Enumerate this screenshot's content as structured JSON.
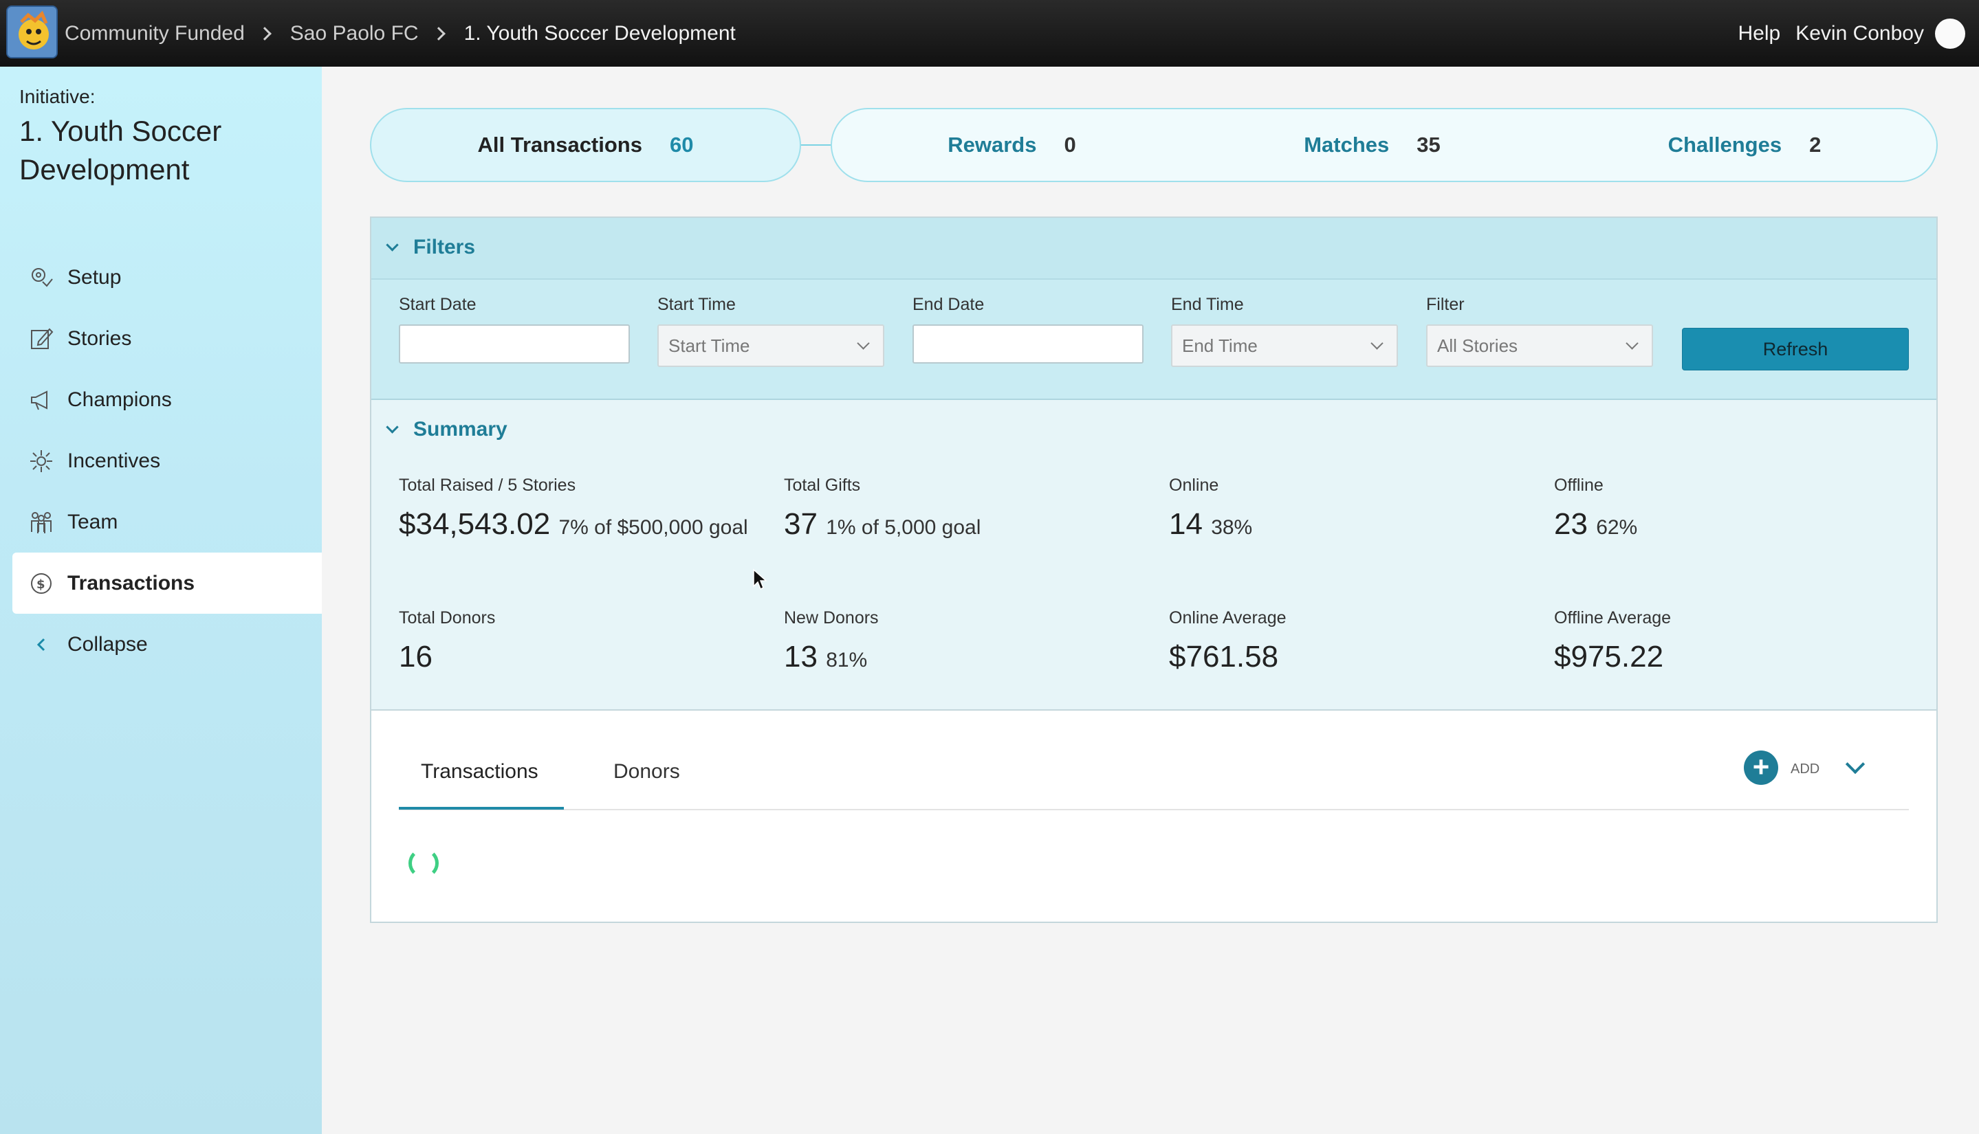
{
  "topbar": {
    "breadcrumbs": [
      "Community Funded",
      "Sao Paolo FC",
      "1. Youth Soccer Development"
    ],
    "help": "Help",
    "user": "Kevin Conboy"
  },
  "sidebar": {
    "initiative_label": "Initiative:",
    "initiative_title": "1. Youth Soccer Development",
    "items": [
      {
        "label": "Setup",
        "icon": "setup-icon"
      },
      {
        "label": "Stories",
        "icon": "edit-icon"
      },
      {
        "label": "Champions",
        "icon": "megaphone-icon"
      },
      {
        "label": "Incentives",
        "icon": "sparkle-icon"
      },
      {
        "label": "Team",
        "icon": "team-icon"
      },
      {
        "label": "Transactions",
        "icon": "money-icon",
        "active": true
      },
      {
        "label": "Collapse",
        "icon": "chevron-left-icon"
      }
    ]
  },
  "tabs": {
    "all": {
      "label": "All Transactions",
      "count": "60"
    },
    "rewards": {
      "label": "Rewards",
      "count": "0"
    },
    "matches": {
      "label": "Matches",
      "count": "35"
    },
    "challenges": {
      "label": "Challenges",
      "count": "2"
    }
  },
  "filters": {
    "title": "Filters",
    "start_date_label": "Start Date",
    "start_time_label": "Start Time",
    "start_time_value": "Start Time",
    "end_date_label": "End Date",
    "end_time_label": "End Time",
    "end_time_value": "End Time",
    "filter_label": "Filter",
    "filter_value": "All Stories",
    "refresh": "Refresh"
  },
  "summary": {
    "title": "Summary",
    "total_raised": {
      "label": "Total Raised / 5 Stories",
      "value": "$34,543.02",
      "sub": "7% of $500,000 goal"
    },
    "total_gifts": {
      "label": "Total Gifts",
      "value": "37",
      "sub": "1% of 5,000 goal"
    },
    "online": {
      "label": "Online",
      "value": "14",
      "sub": "38%"
    },
    "offline": {
      "label": "Offline",
      "value": "23",
      "sub": "62%"
    },
    "total_donors": {
      "label": "Total Donors",
      "value": "16"
    },
    "new_donors": {
      "label": "New Donors",
      "value": "13",
      "sub": "81%"
    },
    "online_avg": {
      "label": "Online Average",
      "value": "$761.58"
    },
    "offline_avg": {
      "label": "Offline Average",
      "value": "$975.22"
    }
  },
  "lower": {
    "tab_transactions": "Transactions",
    "tab_donors": "Donors",
    "add": "ADD"
  },
  "colors": {
    "accent": "#1f7d97",
    "sidebar": "#c6f2fb",
    "spinner": "#3ecf83"
  }
}
